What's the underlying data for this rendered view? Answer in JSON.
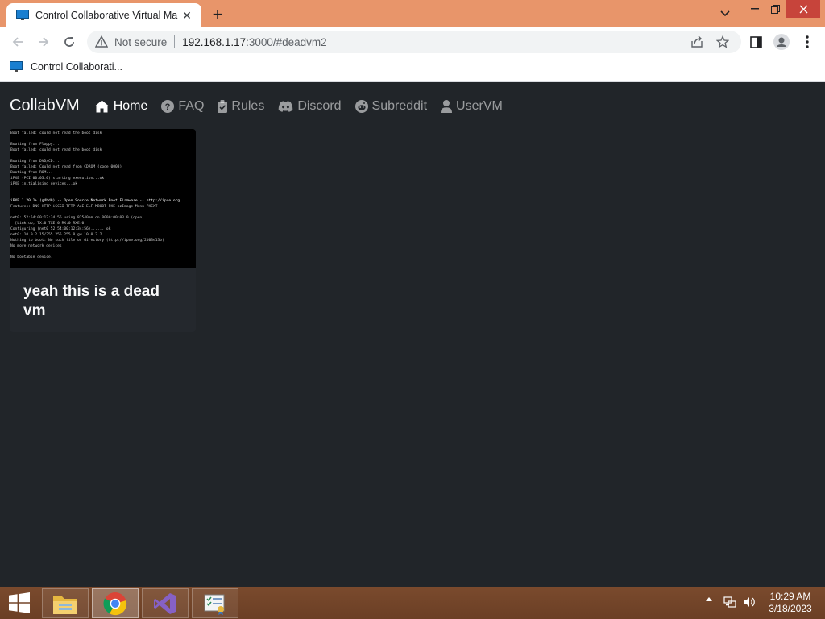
{
  "browser": {
    "tab_title": "Control Collaborative Virtual Ma",
    "url_security": "Not secure",
    "url_host": "192.168.1.17",
    "url_rest": ":3000/#deadvm2",
    "bookmark_label": "Control Collaborati..."
  },
  "navbar": {
    "brand": "CollabVM",
    "links": [
      {
        "label": "Home",
        "icon": "home-icon",
        "active": true
      },
      {
        "label": "FAQ",
        "icon": "question-circle-icon",
        "active": false
      },
      {
        "label": "Rules",
        "icon": "clipboard-check-icon",
        "active": false
      },
      {
        "label": "Discord",
        "icon": "discord-icon",
        "active": false
      },
      {
        "label": "Subreddit",
        "icon": "reddit-icon",
        "active": false
      },
      {
        "label": "UserVM",
        "icon": "user-icon",
        "active": false
      }
    ]
  },
  "vm_card": {
    "title": "yeah this is a dead vm",
    "screen_lines": [
      "Boot failed: could not read the boot disk",
      "",
      "Booting from Floppy...",
      "Boot failed: could not read the boot disk",
      "",
      "Booting from DVD/CD...",
      "Boot failed: Could not read from CDROM (code 0003)",
      "Booting from ROM...",
      "iPXE (PCI 00:03.0) starting execution...ok",
      "iPXE initialising devices...ok",
      "",
      "",
      "iPXE 1.20.1+ (g4bd0) -- Open Source Network Boot Firmware -- http://ipxe.org",
      "Features: DNS HTTP iSCSI TFTP AoE ELF MBOOT PXE bzImage Menu PXEXT",
      "",
      "net0: 52:54:00:12:34:56 using 82540em on 0000:00:03.0 (open)",
      "  [Link:up, TX:0 TXE:0 RX:0 RXE:0]",
      "Configuring (net0 52:54:00:12:34:56)...... ok",
      "net0: 10.0.2.15/255.255.255.0 gw 10.0.2.2",
      "Nothing to boot: No such file or directory (http://ipxe.org/2d03e13b)",
      "No more network devices",
      "",
      "No bootable device."
    ]
  },
  "taskbar": {
    "time": "10:29 AM",
    "date": "3/18/2023"
  }
}
